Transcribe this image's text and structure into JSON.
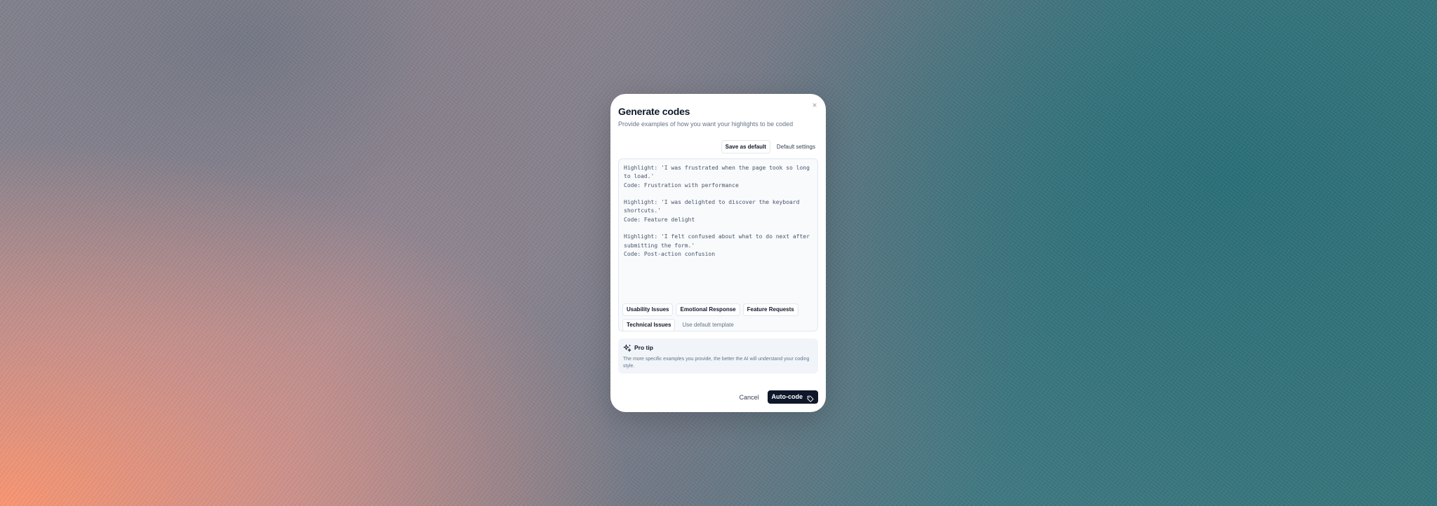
{
  "modal": {
    "close_symbol": "×",
    "title": "Generate codes",
    "subtitle": "Provide examples of how you want your highlights to be coded",
    "save_default_label": "Save as default",
    "default_settings_label": "Default settings",
    "editor_text": "Highlight: 'I was frustrated when the page took so long to load.'\nCode: Frustration with performance\n\nHighlight: 'I was delighted to discover the keyboard shortcuts.'\nCode: Feature delight\n\nHighlight: 'I felt confused about what to do next after submitting the form.'\nCode: Post-action confusion",
    "templates": [
      {
        "label": "Usability Issues"
      },
      {
        "label": "Emotional Response"
      },
      {
        "label": "Feature Requests"
      },
      {
        "label": "Technical Issues"
      }
    ],
    "use_default_template_label": "Use default template",
    "tip": {
      "icon": "sparkles-icon",
      "title": "Pro tip",
      "text": "The more specific examples you provide, the better the AI will understand your coding style."
    },
    "cancel_label": "Cancel",
    "autocode_label": "Auto-code",
    "autocode_icon": "tag-icon"
  },
  "colors": {
    "primary": "#0f172a",
    "muted_text": "#64748b",
    "border": "#e2e8f0",
    "editor_bg": "#f8fafc",
    "tip_bg": "#f1f5f9"
  }
}
